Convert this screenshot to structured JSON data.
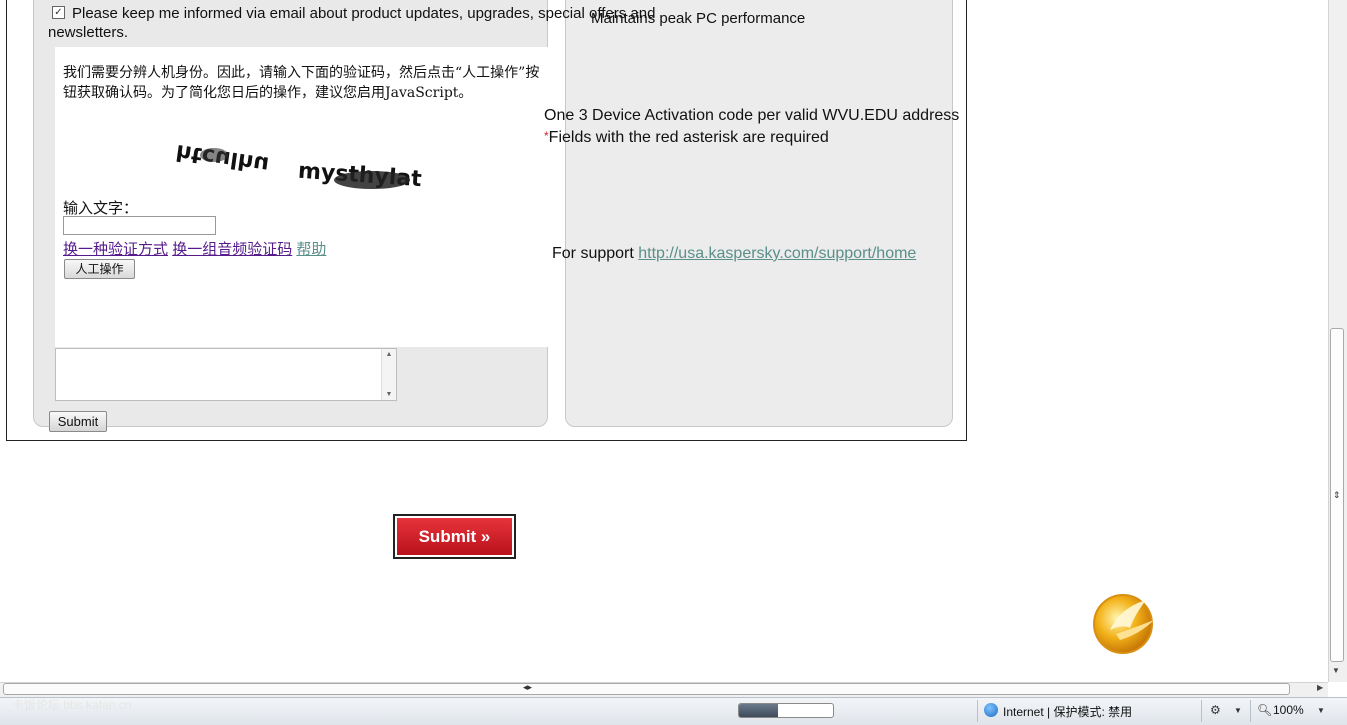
{
  "form": {
    "optin_checked_mark": "✓",
    "optin_text": "Please keep me informed via email about product updates, upgrades, special offers and newsletters.",
    "perf_text": "Maintains peak PC performance",
    "captcha": {
      "instruction": "我们需要分辨人机身份。因此，请输入下面的验证码，然后点击“人工操作”按钮获取确认码。为了简化您日后的操作，建议您启用JavaScript。",
      "word1": "htculhu",
      "word2": "mysthylat",
      "input_label": "输入文字：",
      "input_value": "",
      "link_switch": "换一种验证方式",
      "link_audio": "换一组音频验证码",
      "link_help": "帮助",
      "manual_button": "人工操作"
    },
    "small_submit_label": "Submit",
    "activation_text": "One 3 Device Activation code per valid WVU.EDU address",
    "asterisk": "*",
    "required_text": "Fields with the red asterisk are required",
    "support_prefix": "For support ",
    "support_link": "http://usa.kaspersky.com/support/home"
  },
  "big_submit_label": "Submit »",
  "statusbar": {
    "watermark": "卡饭论坛 bbs.kafan.cn",
    "progress": 0.42,
    "zone": "Internet | 保护模式: 禁用",
    "zoom": "100%"
  },
  "icons": {
    "logo": "kaspersky-logo-icon",
    "globe": "internet-zone-icon"
  },
  "colors": {
    "submit_red": "#c8202a",
    "link_teal": "#5b8f8a",
    "link_visited": "#551a8b"
  }
}
